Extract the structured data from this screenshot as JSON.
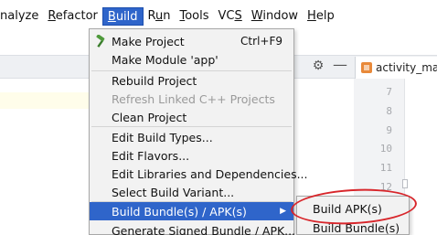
{
  "menubar": {
    "items": [
      {
        "label": "nalyze",
        "underline": ""
      },
      {
        "label": "Refactor",
        "underline": "R"
      },
      {
        "label": "Build",
        "underline": "B"
      },
      {
        "label": "Run",
        "underline": "u"
      },
      {
        "label": "Tools",
        "underline": "T"
      },
      {
        "label": "VCS",
        "underline": "S"
      },
      {
        "label": "Window",
        "underline": "W"
      },
      {
        "label": "Help",
        "underline": "H"
      }
    ]
  },
  "editor": {
    "tab_label": "activity_main",
    "line_numbers": [
      "7",
      "8",
      "9",
      "10",
      "11",
      "12"
    ]
  },
  "build_menu": {
    "make_project": "Make Project",
    "make_project_shortcut": "Ctrl+F9",
    "make_module": "Make Module 'app'",
    "rebuild_project": "Rebuild Project",
    "refresh_cpp": "Refresh Linked C++ Projects",
    "clean_project": "Clean Project",
    "edit_build_types": "Edit Build Types...",
    "edit_flavors": "Edit Flavors...",
    "edit_libraries": "Edit Libraries and Dependencies...",
    "select_build_variant": "Select Build Variant...",
    "build_bundles_apks": "Build Bundle(s) / APK(s)",
    "generate_signed": "Generate Signed Bundle / APK..."
  },
  "submenu": {
    "build_apks": "Build APK(s)",
    "build_bundles": "Build Bundle(s)"
  },
  "colors": {
    "highlight": "#2f65ca",
    "annotation": "#d8262b"
  }
}
